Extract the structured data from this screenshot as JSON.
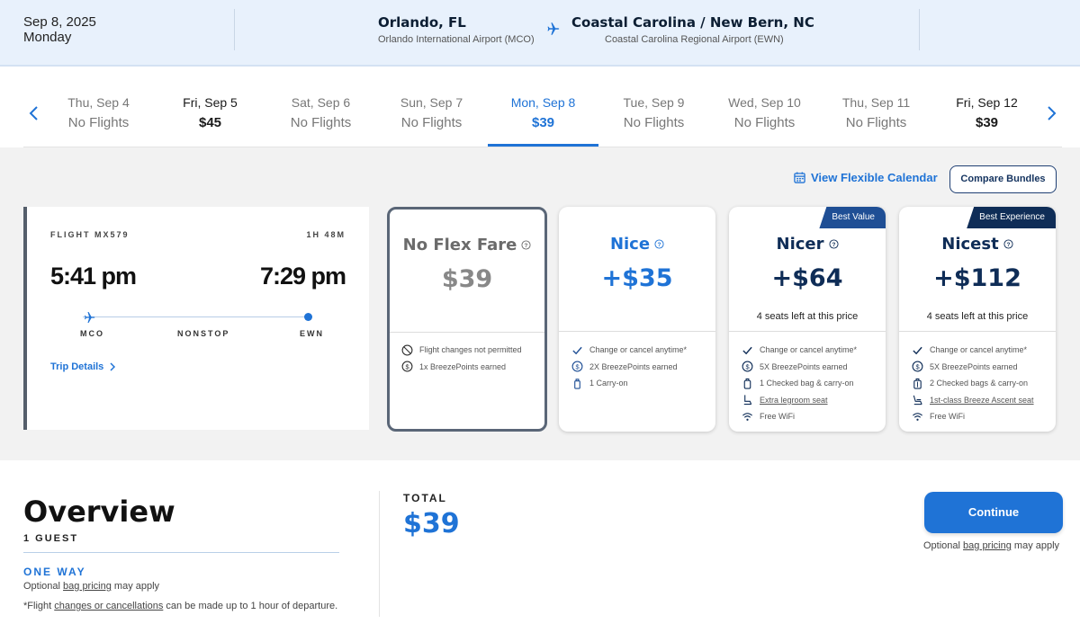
{
  "header": {
    "date": "Sep 8, 2025",
    "weekday": "Monday",
    "origin_city": "Orlando, FL",
    "origin_airport": "Orlando International Airport (MCO)",
    "dest_city": "Coastal Carolina / New Bern, NC",
    "dest_airport": "Coastal Carolina Regional Airport (EWN)"
  },
  "dates": [
    {
      "day": "Thu, Sep 4",
      "price": "No Flights"
    },
    {
      "day": "Fri, Sep 5",
      "price": "$45"
    },
    {
      "day": "Sat, Sep 6",
      "price": "No Flights"
    },
    {
      "day": "Sun, Sep 7",
      "price": "No Flights"
    },
    {
      "day": "Mon, Sep 8",
      "price": "$39"
    },
    {
      "day": "Tue, Sep 9",
      "price": "No Flights"
    },
    {
      "day": "Wed, Sep 10",
      "price": "No Flights"
    },
    {
      "day": "Thu, Sep 11",
      "price": "No Flights"
    },
    {
      "day": "Fri, Sep 12",
      "price": "$39"
    }
  ],
  "actions": {
    "flex_calendar": "View Flexible Calendar",
    "compare_bundles": "Compare Bundles"
  },
  "flight": {
    "number": "FLIGHT MX579",
    "duration": "1H 48M",
    "depart": "5:41 pm",
    "arrive": "7:29 pm",
    "from": "MCO",
    "stops": "NONSTOP",
    "to": "EWN",
    "trip_details": "Trip Details"
  },
  "fares": [
    {
      "name": "No Flex Fare",
      "price": "$39",
      "seats": "",
      "badge": "",
      "features": [
        {
          "icon": "no-icon",
          "text": "Flight changes not permitted"
        },
        {
          "icon": "points-icon",
          "text": "1x BreezePoints earned"
        }
      ]
    },
    {
      "name": "Nice",
      "price": "+$35",
      "seats": "",
      "badge": "",
      "features": [
        {
          "icon": "check-icon",
          "text": "Change or cancel anytime*"
        },
        {
          "icon": "points-icon",
          "text": "2X BreezePoints earned"
        },
        {
          "icon": "carryon-icon",
          "text": "1 Carry-on"
        }
      ]
    },
    {
      "name": "Nicer",
      "price": "+$64",
      "seats": "4 seats left at this price",
      "badge": "Best Value",
      "features": [
        {
          "icon": "check-icon",
          "text": "Change or cancel anytime*"
        },
        {
          "icon": "points-icon",
          "text": "5X BreezePoints earned"
        },
        {
          "icon": "bag-icon",
          "text": "1 Checked bag & carry-on"
        },
        {
          "icon": "seat-icon",
          "text": "Extra legroom seat"
        },
        {
          "icon": "wifi-icon",
          "text": "Free WiFi"
        }
      ]
    },
    {
      "name": "Nicest",
      "price": "+$112",
      "seats": "4 seats left at this price",
      "badge": "Best Experience",
      "features": [
        {
          "icon": "check-icon",
          "text": "Change or cancel anytime*"
        },
        {
          "icon": "points-icon",
          "text": "5X BreezePoints earned"
        },
        {
          "icon": "bag-icon",
          "text": "2 Checked bags & carry-on"
        },
        {
          "icon": "recliner-icon",
          "text": "1st-class Breeze Ascent seat"
        },
        {
          "icon": "wifi-icon",
          "text": "Free WiFi"
        }
      ]
    }
  ],
  "overview": {
    "title": "Overview",
    "guests": "1 GUEST",
    "trip_type": "ONE WAY",
    "bag_prefix": "Optional ",
    "bag_link": "bag pricing",
    "bag_suffix": " may apply",
    "note_prefix": "*Flight ",
    "note_link": "changes or cancellations",
    "note_suffix": " can be made up to 1 hour of departure."
  },
  "total": {
    "label": "TOTAL",
    "value": "$39"
  },
  "continue": {
    "label": "Continue"
  },
  "colors": {
    "accent": "#1f73d6",
    "navy": "#0f2d57",
    "header_bg": "#e8f1fc",
    "panel_bg": "#f2f2f2"
  }
}
